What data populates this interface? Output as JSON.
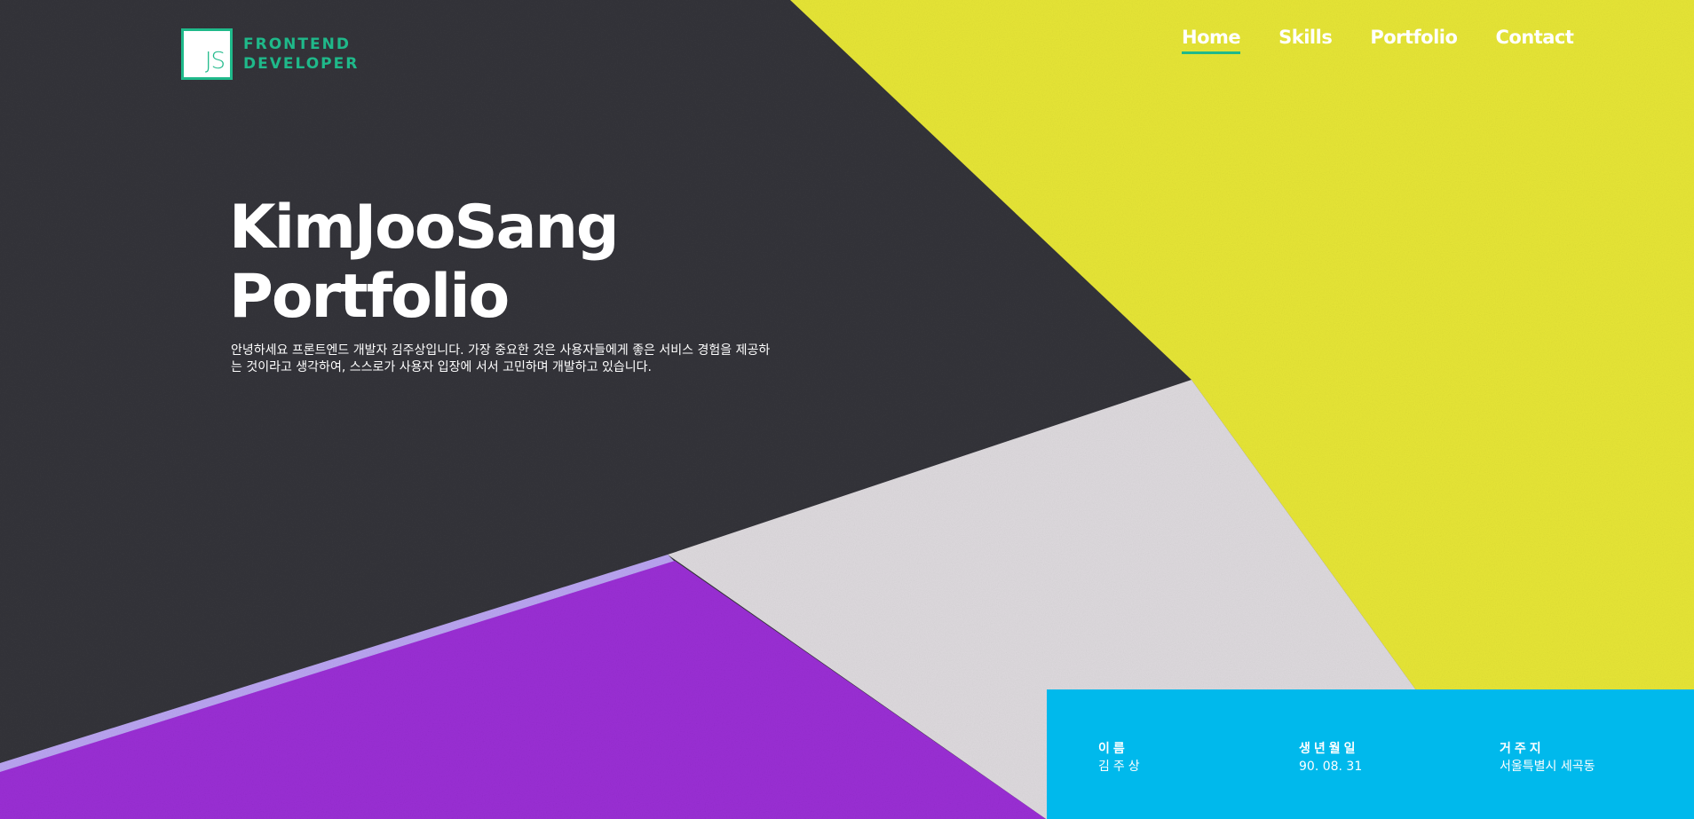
{
  "logo": {
    "mark": "JS",
    "line1": "FRONTEND",
    "line2": "DEVELOPER"
  },
  "nav": {
    "items": [
      {
        "label": "Home",
        "active": true
      },
      {
        "label": "Skills",
        "active": false
      },
      {
        "label": "Portfolio",
        "active": false
      },
      {
        "label": "Contact",
        "active": false
      }
    ]
  },
  "hero": {
    "title_line1": "KimJooSang",
    "title_line2": "Portfolio",
    "intro": "안녕하세요 프론트엔드 개발자 김주상입니다. 가장 중요한 것은 사용자들에게 좋은 서비스 경험을 제공하는 것이라고 생각하여, 스스로가 사용자 입장에 서서 고민하며 개발하고 있습니다."
  },
  "info": {
    "name_label": "이름",
    "name_value": "김주상",
    "birth_label": "생년월일",
    "birth_value": "90. 08. 31",
    "address_label": "거주지",
    "address_value": "서울특별시 세곡동"
  },
  "colors": {
    "accent": "#1fb98a",
    "panel": "#00b9ec",
    "paper_dark": "#34343a",
    "paper_yellow": "#e6e535",
    "paper_gray": "#ddd9dd",
    "paper_purple": "#9a2ed4"
  }
}
